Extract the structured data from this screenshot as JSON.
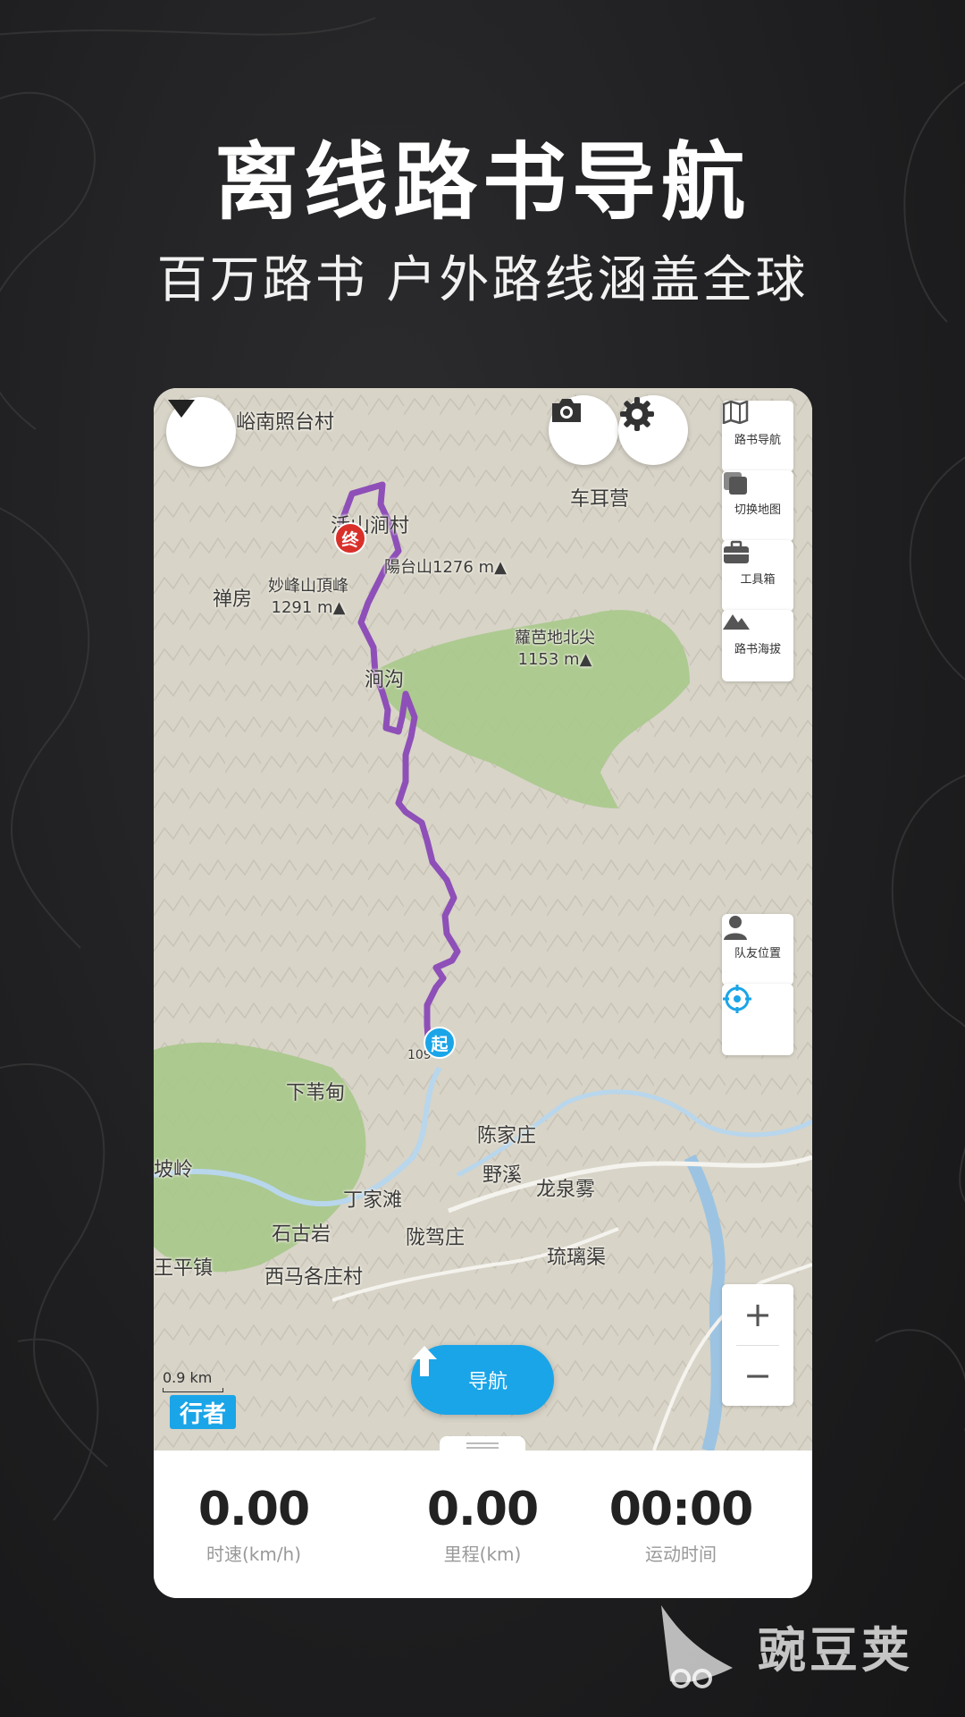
{
  "promo": {
    "headline": "离线路书导航",
    "subline": "百万路书 户外路线涵盖全球"
  },
  "map": {
    "places": {
      "p1": "梁儿峪南照台村",
      "p2": "车耳营",
      "p3": "活山涧村",
      "p4": "陽台山1276 m▲",
      "p5": "禅房",
      "p6": "妙峰山頂峰",
      "p6b": "1291 m▲",
      "p7": "蘿芭地北尖",
      "p7b": "1153 m▲",
      "p8": "涧沟",
      "p9": "下苇甸",
      "p10": "陈家庄",
      "p11": "坡岭",
      "p12": "野溪",
      "p13": "龙泉雾",
      "p14": "丁家滩",
      "p15": "石古岩",
      "p16": "陇驾庄",
      "p17": "琉璃渠",
      "p18": "王平镇",
      "p19": "西马各庄村",
      "road": "109"
    },
    "markers": {
      "end": "终",
      "start": "起"
    },
    "scale": "0.9 km",
    "brand": "行者"
  },
  "controls": {
    "roadbook_nav": "路书导航",
    "switch_map": "切换地图",
    "toolbox": "工具箱",
    "roadbook_elevation": "路书海拔",
    "teammate_location": "队友位置",
    "zoom_in": "+",
    "zoom_out": "−",
    "navigate": "导航"
  },
  "stats": [
    {
      "value": "0.00",
      "label": "时速(km/h)"
    },
    {
      "value": "0.00",
      "label": "里程(km)"
    },
    {
      "value": "00:00",
      "label": "运动时间"
    }
  ],
  "watermark": "豌豆荚",
  "colors": {
    "accent": "#1aa5e8",
    "route": "#8e4fb8",
    "end_marker": "#d9302a"
  }
}
